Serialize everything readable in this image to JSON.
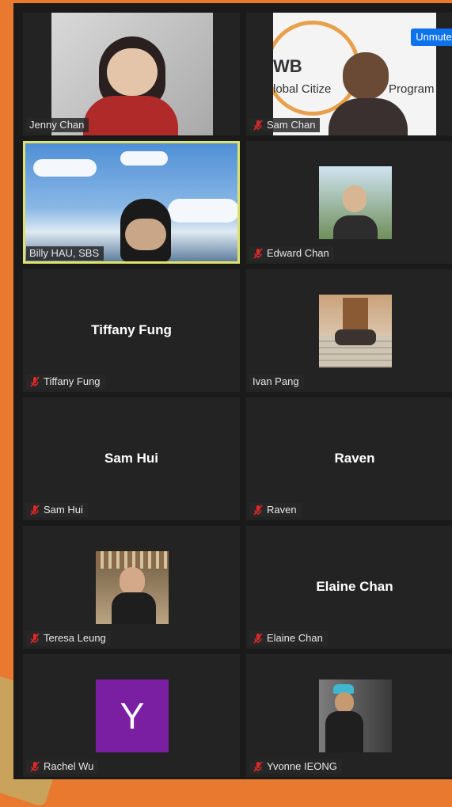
{
  "participants": [
    {
      "name": "Jenny Chan",
      "muted": false,
      "display": "video"
    },
    {
      "name": "Sam Chan",
      "muted": true,
      "display": "video"
    },
    {
      "name": "Billy HAU, SBS",
      "muted": false,
      "display": "video",
      "active_speaker": true
    },
    {
      "name": "Edward Chan",
      "muted": true,
      "display": "photo"
    },
    {
      "name": "Tiffany Fung",
      "muted": true,
      "display": "name"
    },
    {
      "name": "Ivan Pang",
      "muted": false,
      "display": "photo"
    },
    {
      "name": "Sam Hui",
      "muted": true,
      "display": "name"
    },
    {
      "name": "Raven",
      "muted": true,
      "display": "name"
    },
    {
      "name": "Teresa Leung",
      "muted": true,
      "display": "photo"
    },
    {
      "name": "Elaine Chan",
      "muted": true,
      "display": "name"
    },
    {
      "name": "Rachel Wu",
      "muted": true,
      "display": "avatar",
      "avatar_letter": "Y",
      "avatar_color": "#7b1fa2"
    },
    {
      "name": "Yvonne IEONG",
      "muted": true,
      "display": "photo"
    }
  ],
  "center_names": {
    "tiffany": "Tiffany Fung",
    "sam_hui": "Sam Hui",
    "raven": "Raven",
    "elaine": "Elaine Chan"
  },
  "sam_chan_background": {
    "line1": "WB",
    "line2a": "lobal Citize",
    "line2b": "Program"
  },
  "controls": {
    "unmute_label": "Unmute",
    "more_label": "···"
  },
  "colors": {
    "accent": "#0e72ed",
    "active_border": "#dfe36a",
    "mute_red": "#e02828",
    "page_bg": "#e8792e"
  }
}
